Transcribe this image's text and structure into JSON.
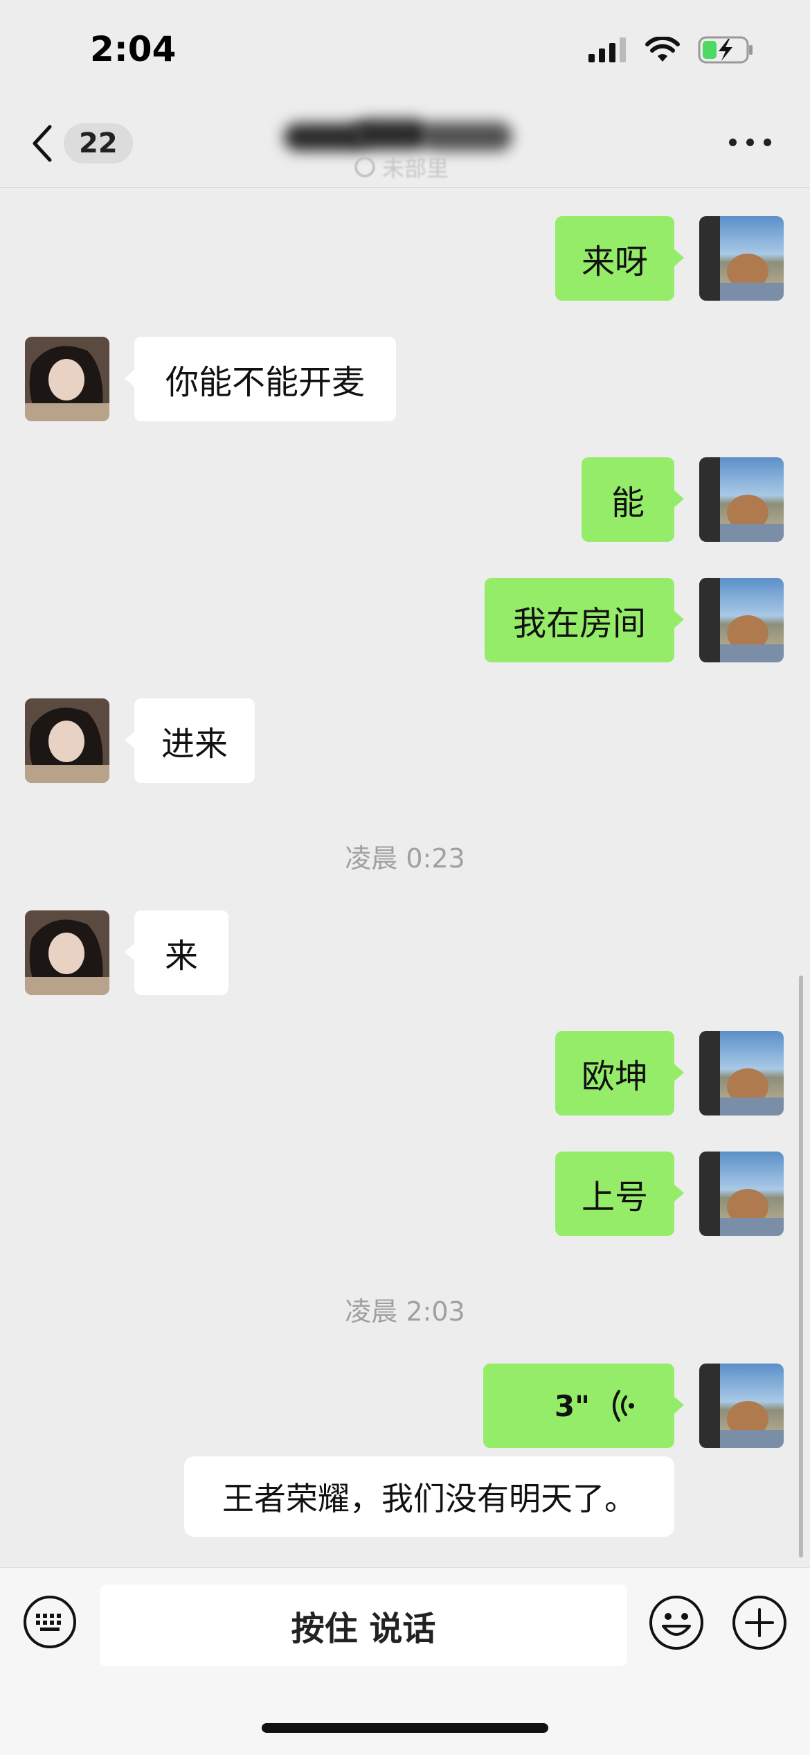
{
  "status_bar": {
    "time": "2:04"
  },
  "nav": {
    "back_count": "22",
    "subtitle": "未部里"
  },
  "messages": [
    {
      "side": "me",
      "text": "来呀"
    },
    {
      "side": "other",
      "text": "你能不能开麦"
    },
    {
      "side": "me",
      "text": "能"
    },
    {
      "side": "me",
      "text": "我在房间"
    },
    {
      "side": "other",
      "text": "进来"
    },
    {
      "timestamp": "凌晨 0:23"
    },
    {
      "side": "other",
      "text": "来"
    },
    {
      "side": "me",
      "text": "欧坤"
    },
    {
      "side": "me",
      "text": "上号"
    },
    {
      "timestamp": "凌晨 2:03"
    },
    {
      "side": "me",
      "type": "voice",
      "duration": "3\"",
      "transcript": "王者荣耀，我们没有明天了。"
    }
  ],
  "input": {
    "talk_label": "按住 说话"
  },
  "colors": {
    "my_bubble": "#95ec69",
    "other_bubble": "#ffffff",
    "background": "#ededed"
  }
}
